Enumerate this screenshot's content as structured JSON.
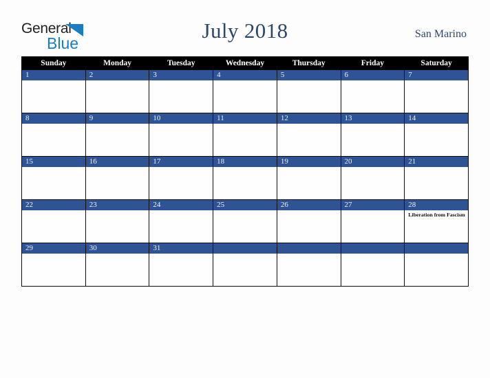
{
  "logo": {
    "word_one": "General",
    "word_two": "Blue",
    "triangle_color": "#1a7cc4",
    "text_color": "#231f20"
  },
  "header": {
    "title": "July 2018",
    "region": "San Marino",
    "title_color": "#2e4668"
  },
  "calendar": {
    "weekday_headers": [
      "Sunday",
      "Monday",
      "Tuesday",
      "Wednesday",
      "Thursday",
      "Friday",
      "Saturday"
    ],
    "header_bg": "#000000",
    "daynum_bg": "#2e5496",
    "daynum_color": "#eef2f8",
    "weeks": [
      [
        {
          "day": "1",
          "events": []
        },
        {
          "day": "2",
          "events": []
        },
        {
          "day": "3",
          "events": []
        },
        {
          "day": "4",
          "events": []
        },
        {
          "day": "5",
          "events": []
        },
        {
          "day": "6",
          "events": []
        },
        {
          "day": "7",
          "events": []
        }
      ],
      [
        {
          "day": "8",
          "events": []
        },
        {
          "day": "9",
          "events": []
        },
        {
          "day": "10",
          "events": []
        },
        {
          "day": "11",
          "events": []
        },
        {
          "day": "12",
          "events": []
        },
        {
          "day": "13",
          "events": []
        },
        {
          "day": "14",
          "events": []
        }
      ],
      [
        {
          "day": "15",
          "events": []
        },
        {
          "day": "16",
          "events": []
        },
        {
          "day": "17",
          "events": []
        },
        {
          "day": "18",
          "events": []
        },
        {
          "day": "19",
          "events": []
        },
        {
          "day": "20",
          "events": []
        },
        {
          "day": "21",
          "events": []
        }
      ],
      [
        {
          "day": "22",
          "events": []
        },
        {
          "day": "23",
          "events": []
        },
        {
          "day": "24",
          "events": []
        },
        {
          "day": "25",
          "events": []
        },
        {
          "day": "26",
          "events": []
        },
        {
          "day": "27",
          "events": []
        },
        {
          "day": "28",
          "events": [
            "Liberation from Fascism"
          ]
        }
      ],
      [
        {
          "day": "29",
          "events": []
        },
        {
          "day": "30",
          "events": []
        },
        {
          "day": "31",
          "events": []
        },
        {
          "day": "",
          "events": []
        },
        {
          "day": "",
          "events": []
        },
        {
          "day": "",
          "events": []
        },
        {
          "day": "",
          "events": []
        }
      ]
    ]
  }
}
